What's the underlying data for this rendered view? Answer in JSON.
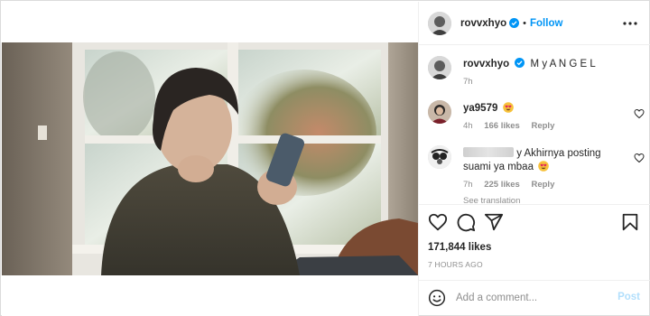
{
  "post": {
    "author": "rovvxhyo",
    "follow_label": "Follow",
    "dot": "•",
    "caption": {
      "username": "rovvxhyo",
      "text": "M y A N G E L",
      "age": "7h"
    },
    "comments": [
      {
        "username": "ya9579",
        "text": "",
        "age": "4h",
        "likes": "166 likes",
        "reply_label": "Reply"
      },
      {
        "username": "",
        "text": "y Akhirnya posting suami ya mbaa",
        "age": "7h",
        "likes": "225 likes",
        "reply_label": "Reply",
        "see_translation": "See translation"
      }
    ],
    "likes_count": "171,844 likes",
    "timestamp": "7 HOURS AGO",
    "comment_input": {
      "placeholder": "Add a comment...",
      "post_label": "Post"
    }
  },
  "colors": {
    "accent": "#0095f6",
    "post_disabled": "#b2dffc",
    "muted": "#8e8e8e",
    "border": "#dbdbdb"
  },
  "icons": {
    "verified": "verified-badge-icon",
    "more": "more-options-icon",
    "like": "heart-icon",
    "comment": "comment-bubble-icon",
    "share": "paper-plane-icon",
    "save": "bookmark-icon",
    "emoji": "smiley-icon",
    "heart_eyes": "heart-eyes-emoji"
  }
}
